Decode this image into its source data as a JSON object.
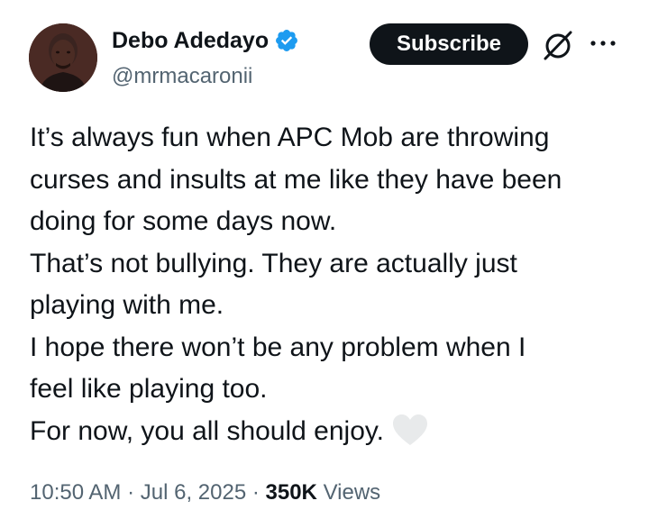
{
  "author": {
    "name": "Debo Adedayo",
    "handle": "@mrmacaronii",
    "verified": true,
    "avatar_icon": "profile-photo"
  },
  "header": {
    "subscribe_label": "Subscribe",
    "grok_icon": "grok-icon",
    "more_icon": "more-horizontal-icon"
  },
  "tweet": {
    "lines": [
      "It’s always fun when APC Mob are throwing",
      "curses and insults at me like they have been",
      "doing for some days now.",
      "That’s not bullying. They are actually just",
      "playing with me.",
      "I hope there won’t be any problem when I",
      "feel like playing too.",
      "For now, you all should enjoy."
    ],
    "emoji": "white-heart-icon"
  },
  "meta": {
    "time": "10:50 AM",
    "separator": "·",
    "date": "Jul 6, 2025",
    "views_count": "350K",
    "views_label": "Views"
  },
  "colors": {
    "text": "#0f1419",
    "secondary": "#536471",
    "verified": "#1d9bf0",
    "button_bg": "#0f1419",
    "heart": "#e8eaeb"
  }
}
